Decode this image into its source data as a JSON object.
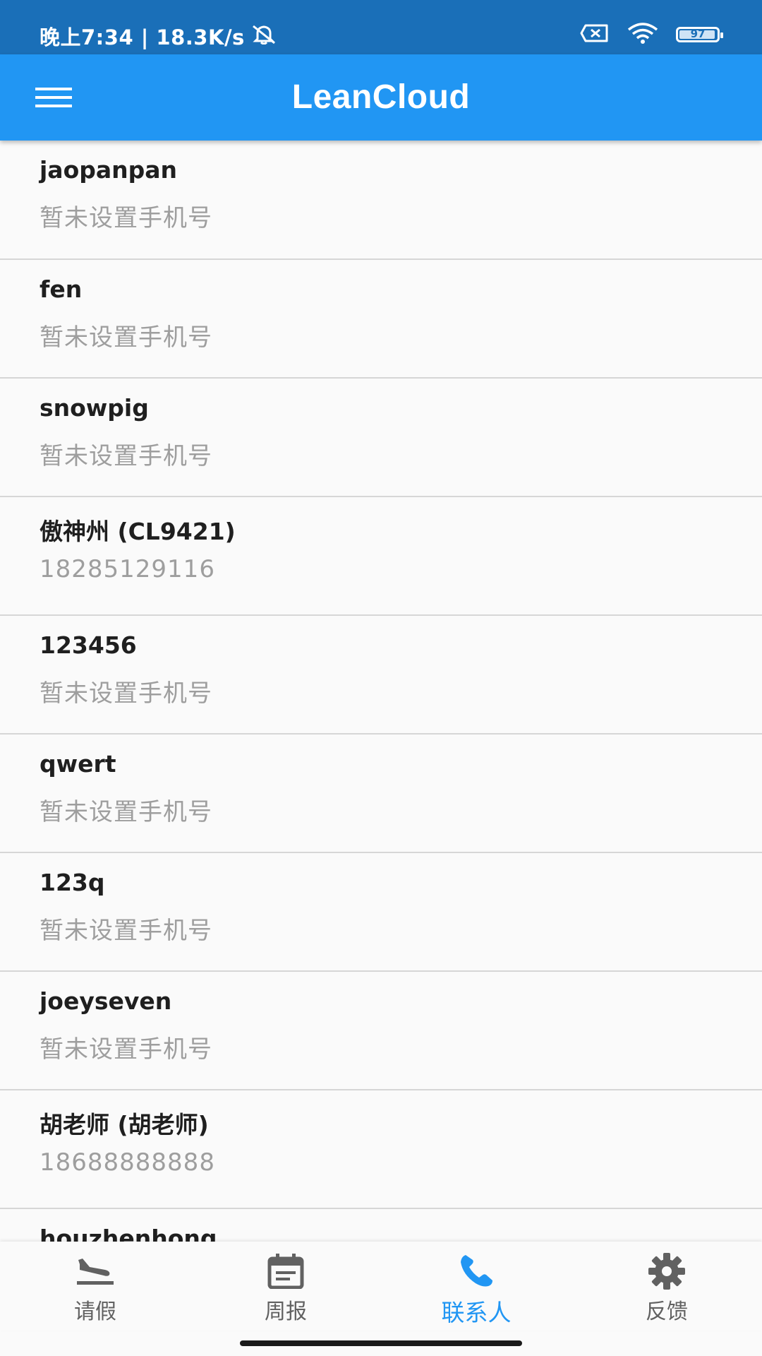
{
  "status_bar": {
    "time_text": "晚上7:34 | 18.3K/s",
    "battery_level": "97",
    "battery_fraction": 0.97,
    "icons": [
      "bell-off-icon",
      "sim-x-icon",
      "wifi-icon",
      "battery-icon"
    ]
  },
  "app_bar": {
    "title": "LeanCloud",
    "menu_icon": "hamburger-menu-icon"
  },
  "contacts": [
    {
      "name": "jaopanpan",
      "phone": "暂未设置手机号"
    },
    {
      "name": "fen",
      "phone": "暂未设置手机号"
    },
    {
      "name": "snowpig",
      "phone": "暂未设置手机号"
    },
    {
      "name": "傲神州 (CL9421)",
      "phone": "18285129116"
    },
    {
      "name": "123456",
      "phone": "暂未设置手机号"
    },
    {
      "name": "qwert",
      "phone": "暂未设置手机号"
    },
    {
      "name": "123q",
      "phone": "暂未设置手机号"
    },
    {
      "name": "joeyseven",
      "phone": "暂未设置手机号"
    },
    {
      "name": "胡老师 (胡老师)",
      "phone": "18688888888"
    },
    {
      "name": "houzhenhong",
      "phone": ""
    }
  ],
  "bottom_nav": {
    "items": [
      {
        "label": "请假",
        "icon": "airplane-landing-icon",
        "active": false
      },
      {
        "label": "周报",
        "icon": "calendar-icon",
        "active": false
      },
      {
        "label": "联系人",
        "icon": "phone-icon",
        "active": true
      },
      {
        "label": "反馈",
        "icon": "gear-icon",
        "active": false
      }
    ]
  },
  "colors": {
    "status_bar": "#1a6fb8",
    "app_bar": "#2196f3",
    "active_nav": "#2196f3",
    "inactive_nav": "#616161",
    "secondary_text": "#9e9e9e"
  }
}
